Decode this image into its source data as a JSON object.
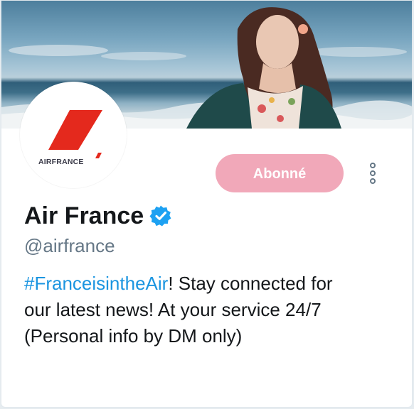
{
  "profile": {
    "logo_text": "AIRFRANCE",
    "follow_label": "Abonné",
    "name": "Air France",
    "handle": "@airfrance",
    "bio_hashtag": "#FranceisintheAir",
    "bio_line1_rest": "! Stay connected for",
    "bio_line2": "our latest news! At your service 24/7",
    "bio_line3": "(Personal info by DM only)"
  },
  "icons": {
    "verified": "verified-badge-icon",
    "more": "more-options-icon",
    "logo": "air-france-logo-icon"
  },
  "colors": {
    "follow_button": "#f1a8b9",
    "hashtag": "#1b95e0",
    "verified": "#1da1f2",
    "logo_red": "#e4291d",
    "handle": "#657786"
  }
}
